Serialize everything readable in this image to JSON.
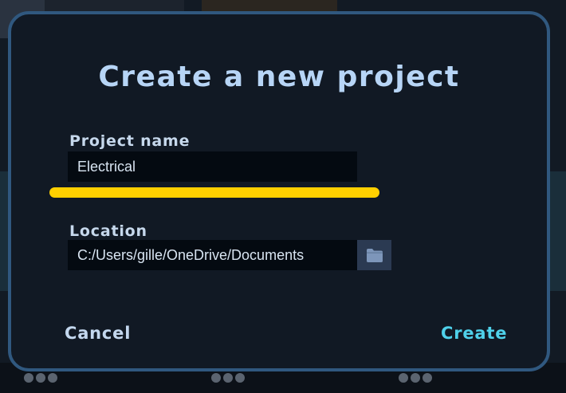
{
  "dialog": {
    "title": "Create a new project",
    "project_name": {
      "label": "Project name",
      "value": "Electrical"
    },
    "location": {
      "label": "Location",
      "value": "C:/Users/gille/OneDrive/Documents",
      "browse_icon": "folder-icon"
    },
    "buttons": {
      "cancel": "Cancel",
      "create": "Create"
    }
  },
  "colors": {
    "dialog_background": "#111924",
    "dialog_border": "#30587f",
    "title_text": "#b7d5f6",
    "input_background": "#040a11",
    "highlight": "#ffd000",
    "create_accent": "#4fd1ea",
    "folder_button": "#2b3a52"
  }
}
